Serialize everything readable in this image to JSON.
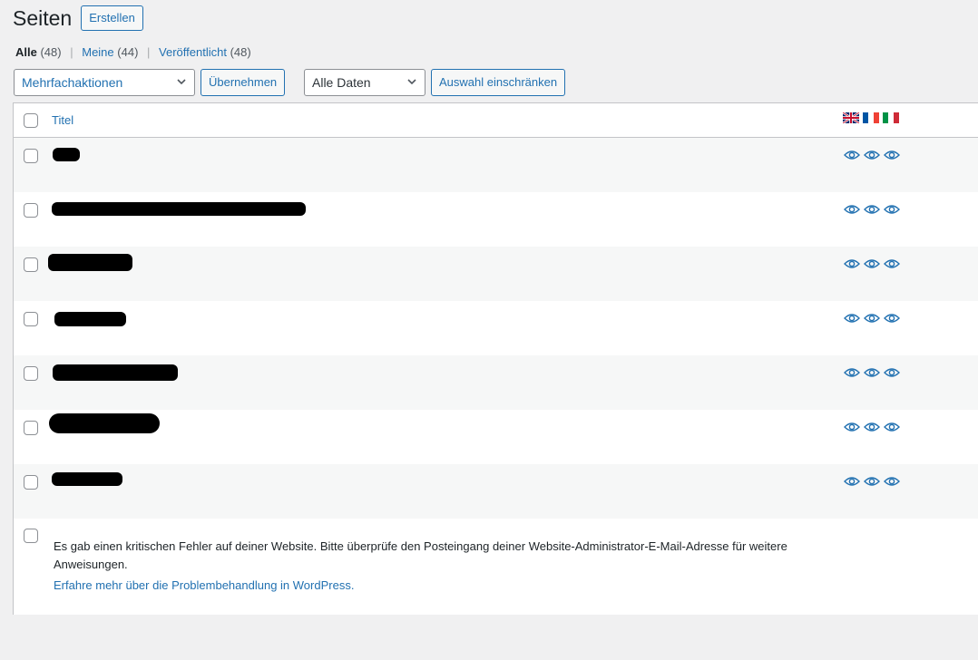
{
  "header": {
    "title": "Seiten",
    "add_new_label": "Erstellen"
  },
  "views": [
    {
      "label": "Alle",
      "count": "(48)"
    },
    {
      "label": "Meine",
      "count": "(44)"
    },
    {
      "label": "Veröffentlicht",
      "count": "(48)"
    }
  ],
  "tablenav": {
    "bulk_actions": "Mehrfachaktionen",
    "apply_label": "Übernehmen",
    "date_filter": "Alle Daten",
    "filter_label": "Auswahl einschränken"
  },
  "table": {
    "column_title": "Titel",
    "language_flags": [
      "flag-uk-icon",
      "flag-fr-icon",
      "flag-it-icon"
    ],
    "rows_count": 7
  },
  "error_notice": {
    "text": "Es gab einen kritischen Fehler auf deiner Website. Bitte überprüfe den Posteingang deiner Website-Administrator-E-Mail-Adresse für weitere Anweisungen.",
    "link": "Erfahre mehr über die Problembehandlung in WordPress."
  },
  "colors": {
    "accent": "#2271b1",
    "background": "#f0f0f1",
    "alt_row": "#f6f7f7",
    "border": "#c3c4c7"
  }
}
